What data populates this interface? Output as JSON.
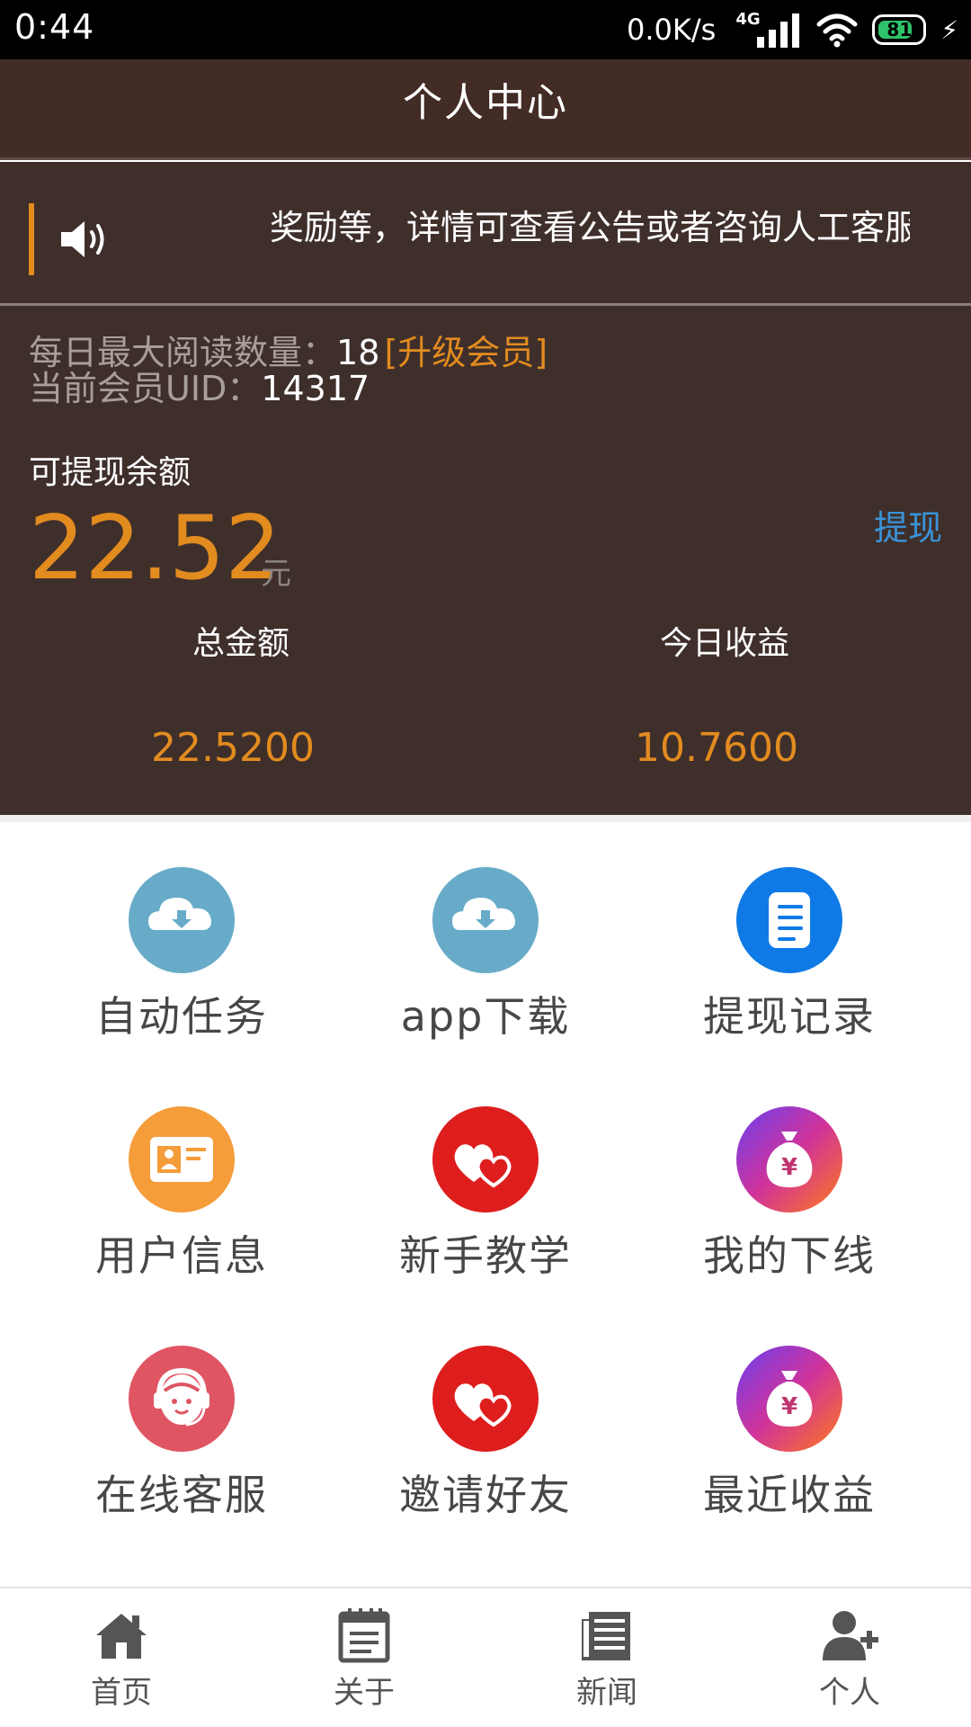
{
  "status": {
    "time": "0:44",
    "speed": "0.0K/s",
    "network": "4G",
    "battery": "81",
    "battery_level": 0.81
  },
  "header": {
    "title": "个人中心"
  },
  "notice": {
    "text": "奖励等，详情可查看公告或者咨询人工客服"
  },
  "account": {
    "daily_max_label": "每日最大阅读数量：",
    "daily_max_value": "18",
    "upgrade_label": "[升级会员]",
    "uid_label": "当前会员UID：",
    "uid_value": "14317",
    "withdrawable_label": "可提现余额",
    "withdrawable_amount": "22.52",
    "unit": "元",
    "withdraw_label": "提现",
    "total_label": "总金额",
    "total_value": "22.5200",
    "today_label": "今日收益",
    "today_value": "10.7600"
  },
  "grid": [
    {
      "label": "自动任务",
      "icon": "cloud-download-icon",
      "color": "#67abc8"
    },
    {
      "label": "app下载",
      "icon": "cloud-download-icon",
      "color": "#67abc8"
    },
    {
      "label": "提现记录",
      "icon": "document-icon",
      "color": "#0f7ae6"
    },
    {
      "label": "用户信息",
      "icon": "id-card-icon",
      "color": "#f59c3b"
    },
    {
      "label": "新手教学",
      "icon": "heart-chat-icon",
      "color": "#de1d1d"
    },
    {
      "label": "我的下线",
      "icon": "money-bag-icon",
      "color": "#9b3fe0"
    },
    {
      "label": "在线客服",
      "icon": "headset-agent-icon",
      "color": "#e05563"
    },
    {
      "label": "邀请好友",
      "icon": "heart-chat-icon",
      "color": "#de1d1d"
    },
    {
      "label": "最近收益",
      "icon": "money-bag-icon",
      "color": "#9b3fe0"
    }
  ],
  "nav": [
    {
      "label": "首页",
      "icon": "home-icon"
    },
    {
      "label": "关于",
      "icon": "notepad-icon"
    },
    {
      "label": "新闻",
      "icon": "newspaper-icon"
    },
    {
      "label": "个人",
      "icon": "add-user-icon"
    }
  ]
}
